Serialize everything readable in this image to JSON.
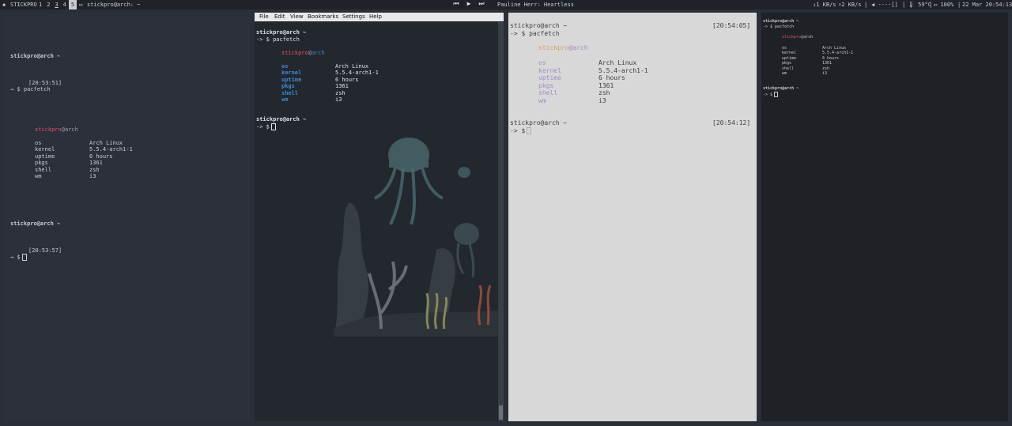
{
  "statusbar": {
    "distro_icon": "penguin-icon",
    "hostname": "STICKPRO",
    "workspaces": [
      "1",
      "2",
      "3",
      "4",
      "5"
    ],
    "active_workspace": "5",
    "window_icon": "terminal-icon",
    "window_title": "stickpro@arch: ~",
    "now_playing": "Pauline Herr: Heartless",
    "down": "↓1 KB/s",
    "up": "↑2 KB/s",
    "volume": "◀ ----[]",
    "temperature": "🌡 59°C",
    "battery": "▭ 100%",
    "datetime": "22 Mar 20:54:13"
  },
  "pane1": {
    "prompt1": "stickpro@arch ~",
    "time1": "[20:53:51]",
    "cmd": "→ $ pacfetch",
    "user": "stickpro",
    "host": "arch",
    "info": [
      {
        "key": "os",
        "value": "Arch Linux"
      },
      {
        "key": "kernel",
        "value": "5.5.4-arch1-1"
      },
      {
        "key": "uptime",
        "value": "6 hours"
      },
      {
        "key": "pkgs",
        "value": "1361"
      },
      {
        "key": "shell",
        "value": "zsh"
      },
      {
        "key": "wm",
        "value": "i3"
      }
    ],
    "prompt2": "stickpro@arch ~",
    "time2": "[20:53:57]",
    "cmd2": "→ $"
  },
  "pane2": {
    "menu": [
      "File",
      "Edit",
      "View",
      "Bookmarks",
      "Settings",
      "Help"
    ],
    "prompt1": "stickpro@arch ~",
    "cmd": "-> $ pacfetch",
    "user": "stickpro",
    "host": "arch",
    "info": [
      {
        "key": "os",
        "value": "Arch Linux"
      },
      {
        "key": "kernel",
        "value": "5.5.4-arch1-1"
      },
      {
        "key": "uptime",
        "value": "6 hours"
      },
      {
        "key": "pkgs",
        "value": "1361"
      },
      {
        "key": "shell",
        "value": "zsh"
      },
      {
        "key": "wm",
        "value": "i3"
      }
    ],
    "prompt2": "stickpro@arch ~",
    "cmd2": "-> $"
  },
  "pane3": {
    "prompt1": "stickpro@arch ~",
    "time1": "[20:54:05]",
    "cmd": "-> $ pacfetch",
    "user": "stickpro",
    "host": "arch",
    "info": [
      {
        "key": "os",
        "value": "Arch Linux"
      },
      {
        "key": "kernel",
        "value": "5.5.4-arch1-1"
      },
      {
        "key": "uptime",
        "value": "6 hours"
      },
      {
        "key": "pkgs",
        "value": "1361"
      },
      {
        "key": "shell",
        "value": "zsh"
      },
      {
        "key": "wm",
        "value": "i3"
      }
    ],
    "prompt2": "stickpro@arch ~",
    "time2": "[20:54:12]",
    "cmd2": "-> $"
  },
  "pane4": {
    "prompt1": "stickpro@arch ~",
    "cmd": "-> $ pacfetch",
    "user": "stickpro",
    "host": "arch",
    "info": [
      {
        "key": "os",
        "value": "Arch Linux"
      },
      {
        "key": "kernel",
        "value": "5.5.4-arch1-1"
      },
      {
        "key": "uptime",
        "value": "6 hours"
      },
      {
        "key": "pkgs",
        "value": "1361"
      },
      {
        "key": "shell",
        "value": "zsh"
      },
      {
        "key": "wm",
        "value": "i3"
      }
    ],
    "prompt2": "stickpro@arch ~",
    "cmd2": "-> $"
  }
}
